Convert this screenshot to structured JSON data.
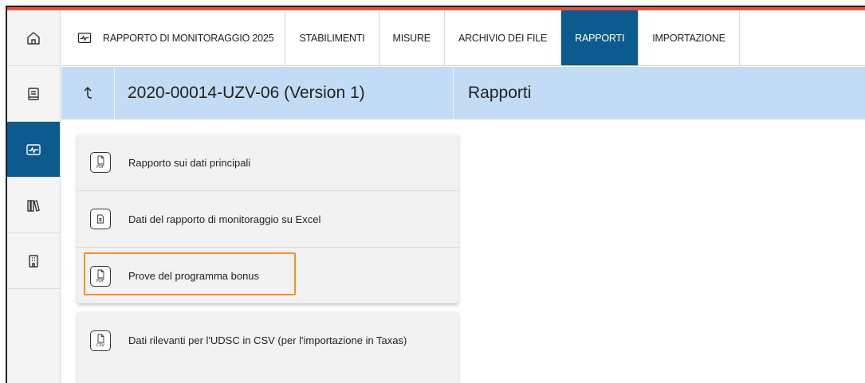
{
  "topnav": {
    "home_label": "RAPPORTO DI MONITORAGGIO 2025",
    "tabs": [
      {
        "label": "STABILIMENTI",
        "active": false
      },
      {
        "label": "MISURE",
        "active": false
      },
      {
        "label": "ARCHIVIO DEI FILE",
        "active": false
      },
      {
        "label": "RAPPORTI",
        "active": true
      },
      {
        "label": "IMPORTAZIONE",
        "active": false
      }
    ]
  },
  "rail": {
    "items": [
      {
        "icon": "home-icon"
      },
      {
        "icon": "document-icon"
      },
      {
        "icon": "monitor-icon",
        "active": true
      },
      {
        "icon": "library-icon"
      },
      {
        "icon": "building-icon"
      }
    ]
  },
  "breadcrumb": {
    "back_icon": "back-arrow-icon",
    "project": "2020-00014-UZV-06 (Version 1)",
    "section": "Rapporti"
  },
  "reports": [
    {
      "label": "Rapporto sui dati principali",
      "icon": "pdf-icon",
      "tag": "PDF"
    },
    {
      "label": "Dati del rapporto di monitoraggio su Excel",
      "icon": "excel-icon",
      "tag": ""
    },
    {
      "label": "Prove del programma bonus",
      "icon": "pdf-icon",
      "tag": "PDF",
      "highlighted": true
    },
    {
      "label": "Dati rilevanti per l'UDSC in CSV (per l'importazione in Taxas)",
      "icon": "csv-icon",
      "tag": "CSV"
    }
  ],
  "colors": {
    "accent": "#e0533a",
    "active_tab": "#0c5a8e",
    "breadcrumb_bg": "#c3dcf5",
    "highlight": "#f39128"
  }
}
